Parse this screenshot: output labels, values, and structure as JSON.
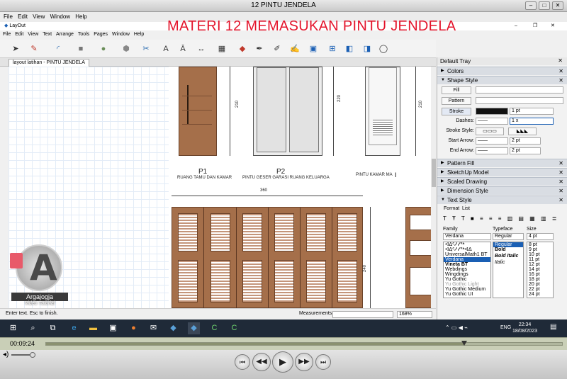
{
  "player": {
    "title": "12 PINTU JENDELA",
    "menu": [
      "File",
      "Edit",
      "View",
      "Window",
      "Help"
    ],
    "time": "00:09:24",
    "progress": 0.81
  },
  "overlay_text": "MATERI 12  MEMASUKAN  PINTU JENDELA",
  "app": {
    "title": "LayOut",
    "menu": [
      "File",
      "Edit",
      "View",
      "Text",
      "Arrange",
      "Tools",
      "Pages",
      "Window",
      "Help"
    ],
    "doc_tab": "layout latihan - PINTU JENDELA"
  },
  "drawing": {
    "p1_code": "P1",
    "p1_label": "RUANG TAMU DAN KAMAR",
    "p2_code": "P2",
    "p2_label": "PINTU GESER GARASI RUANG KELUARGA",
    "p3_label": "PINTU KAMAR MA",
    "dim_210a": "210",
    "dim_220": "220",
    "dim_210b": "210",
    "dim_360": "360",
    "dim_240": "240"
  },
  "status": {
    "hint": "Enter text.  Esc to finish.",
    "measurements_label": "Measurements",
    "zoom": "168%"
  },
  "tray": {
    "title": "Default Tray",
    "sections": {
      "colors": "Colors",
      "shape_style": "Shape Style",
      "pattern_fill": "Pattern Fill",
      "sketchup_model": "SketchUp Model",
      "scaled_drawing": "Scaled Drawing",
      "dimension_style": "Dimension Style",
      "text_style": "Text Style"
    },
    "shape": {
      "fill": "Fill",
      "pattern": "Pattern",
      "stroke": "Stroke",
      "stroke_width": "1 pt",
      "dashes": "Dashes:",
      "dash_scale": "1 x",
      "stroke_style": "Stroke Style:",
      "start_arrow": "Start Arrow:",
      "end_arrow": "End Arrow:",
      "start_size": "2 pt",
      "end_size": "2 pt"
    },
    "text_style": {
      "tab_format": "Format",
      "tab_list": "List",
      "family_label": "Family",
      "typeface_label": "Typeface",
      "size_label": "Size",
      "family_value": "Verdana",
      "typeface_value": "Regular",
      "size_value": "4 pt",
      "families": [
        "ᐊᐃᑦᓱᓯᖅ",
        "ᐊᐃᑦᓱᓯᖅᐊᐃ",
        "UniversalMath1 BT",
        "Verdana",
        "Vineta BT",
        "Webdings",
        "Wingdings",
        "Yu Gothic",
        "Yu Gothic Light",
        "Yu Gothic Medium",
        "Yu Gothic UI"
      ],
      "typefaces": [
        "Regular",
        "Bold",
        "Bold Italic",
        "Italic"
      ],
      "sizes": [
        "8 pt",
        "9 pt",
        "10 pt",
        "11 pt",
        "12 pt",
        "14 pt",
        "16 pt",
        "18 pt",
        "20 pt",
        "22 pt",
        "24 pt",
        "26 pt"
      ]
    }
  },
  "taskbar": {
    "lang": "ENG",
    "time": "22:34",
    "date": "18/08/2023"
  },
  "logo": {
    "letter": "A",
    "name": "Argajogja",
    "sub": "Video Tutorial"
  },
  "colors": {
    "overlay": "#e4142b",
    "wood": "#a56f4a",
    "taskbar": "#1f2a38"
  }
}
